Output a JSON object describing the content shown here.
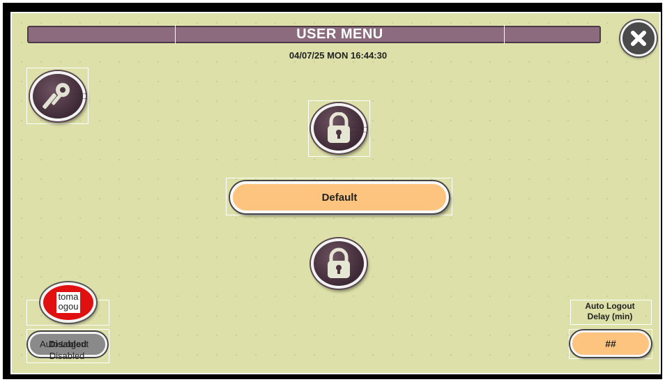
{
  "header": {
    "title": "USER MENU",
    "datetime": "04/07/25 MON 16:44:30"
  },
  "buttons": {
    "default_label": "Default",
    "delay_value": "##"
  },
  "auto_logout": {
    "delay_label_line1": "Auto Logout",
    "delay_label_line2": "Delay (min)",
    "toggle_text": "toma\nogou",
    "overlap_text_a": "Auto Logout",
    "overlap_text_b": "Disabled",
    "status_text": "Disabled"
  },
  "icons": {
    "close": "close-icon",
    "keys": "keys-icon",
    "lock_open": "unlock-icon",
    "lock": "lock-icon"
  },
  "colors": {
    "background": "#dde0a8",
    "titlebar": "#8b6b7d",
    "pill": "#fdc47f",
    "toggle_red": "#e01010"
  }
}
